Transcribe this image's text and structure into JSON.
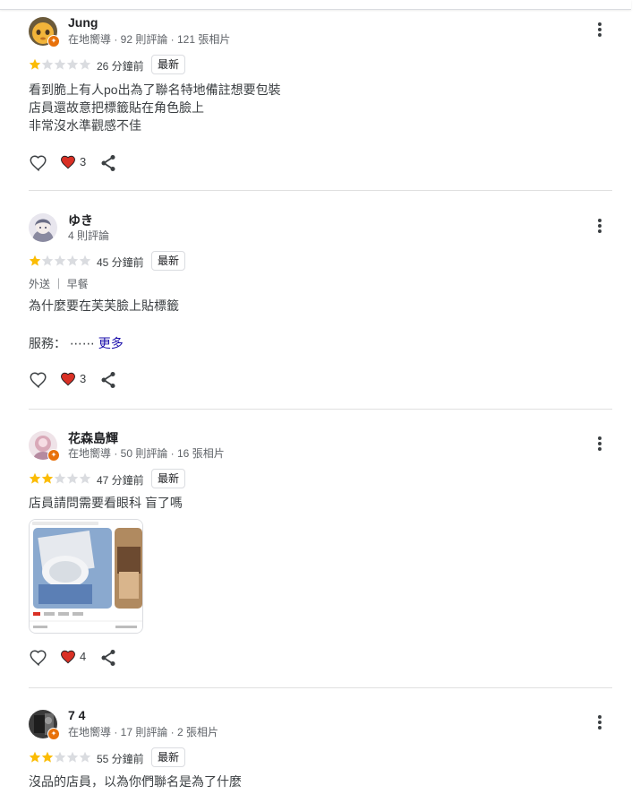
{
  "reviews": [
    {
      "name": "Jung",
      "meta": "在地嚮導 · 92 則評論 · 121 張相片",
      "rating": 1,
      "time": "26 分鐘前",
      "badge": "最新",
      "text": "看到脆上有人po出為了聯名特地備註想要包裝\n店員還故意把標籤貼在角色臉上\n非常沒水準觀感不佳",
      "heart_count": "3"
    },
    {
      "name": "ゆき",
      "meta": "4 則評論",
      "rating": 1,
      "time": "45 分鐘前",
      "badge": "最新",
      "tags": "外送 ｜ 早餐",
      "text": "為什麼要在芙芙臉上貼標籤",
      "service_label": "服務：",
      "service_ellipsis": "⋯⋯",
      "more_link": "更多",
      "heart_count": "3"
    },
    {
      "name": "花森島輝",
      "meta": "在地嚮導 · 50 則評論 · 16 張相片",
      "rating": 2,
      "time": "47 分鐘前",
      "badge": "最新",
      "text": "店員請問需要看眼科 盲了嗎",
      "heart_count": "4"
    },
    {
      "name": "7 4",
      "meta": "在地嚮導 · 17 則評論 · 2 張相片",
      "rating": 2,
      "time": "55 分鐘前",
      "badge": "最新",
      "text": "沒品的店員，以為你們聯名是為了什麼"
    }
  ],
  "colors": {
    "star_filled": "#fbbc04",
    "star_empty": "#dadce0",
    "heart_red": "#d93025",
    "link_blue": "#1a0dab",
    "guide_badge": "#e8710a"
  },
  "icons": [
    "heart-outline-icon",
    "heart-filled-icon",
    "share-icon",
    "more-vert-icon",
    "local-guide-badge-icon"
  ]
}
